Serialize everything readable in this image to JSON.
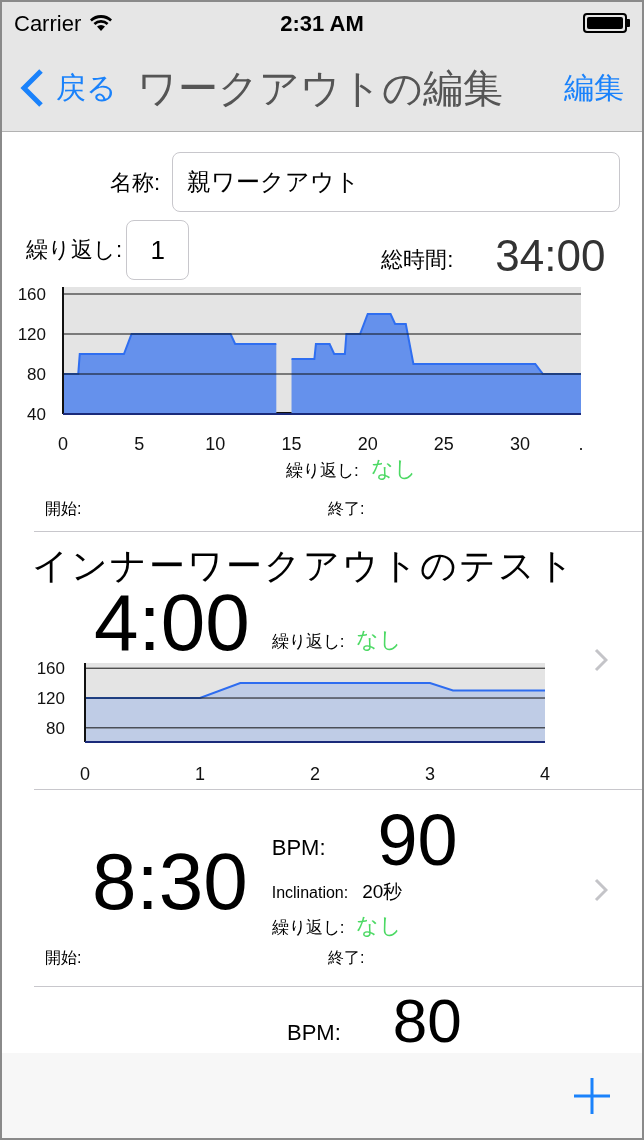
{
  "status_bar": {
    "carrier": "Carrier",
    "time": "2:31 AM"
  },
  "nav": {
    "back": "戻る",
    "title": "ワークアウトの編集",
    "action": "編集"
  },
  "name_field": {
    "label": "名称:",
    "value": "親ワークアウト"
  },
  "repeat_field": {
    "label": "繰り返し:",
    "value": "1"
  },
  "total": {
    "label": "総時間:",
    "value": "34:00"
  },
  "chart": {
    "chart_data": {
      "type": "area",
      "x": [
        0,
        1,
        1.1,
        4,
        4.5,
        11,
        11.3,
        14,
        14.5,
        15,
        16.5,
        16.6,
        17.5,
        17.8,
        18.5,
        18.6,
        19.5,
        20,
        21.5,
        21.8,
        22.5,
        23,
        31,
        31.5,
        34
      ],
      "grid": true,
      "series": [
        {
          "color": "#2f6ef0",
          "values": [
            80,
            80,
            100,
            100,
            120,
            120,
            110,
            110,
            null,
            95,
            95,
            110,
            110,
            100,
            100,
            120,
            120,
            140,
            140,
            130,
            130,
            90,
            90,
            80,
            80
          ]
        }
      ],
      "xlim": [
        0,
        34
      ],
      "ylim": [
        40,
        167
      ],
      "xticks": [
        0,
        5,
        10,
        15,
        20,
        25,
        30,
        {
          "value": 34,
          "label": "."
        }
      ],
      "yticks": [
        40,
        80,
        120,
        160
      ]
    }
  },
  "repeat": {
    "label": "繰り返し:",
    "value": "なし"
  },
  "start_label": "開始:",
  "end_label": "終了:",
  "items": [
    {
      "kind": "chart",
      "title": "インナーワークアウトのテスト",
      "time": "4:00",
      "repeat_label": "繰り返し:",
      "repeat_value": "なし",
      "chart_data": {
        "type": "area",
        "x": [
          0,
          1,
          1.35,
          3,
          3.2,
          4
        ],
        "grid": true,
        "series": [
          {
            "color": "#2d6cf0",
            "values": [
              120,
              120,
              140,
              140,
              130,
              130
            ]
          }
        ],
        "xlim": [
          0,
          4
        ],
        "ylim": [
          61,
          167
        ],
        "xticks": [
          0,
          1,
          2,
          3,
          4
        ],
        "yticks": [
          80,
          120,
          160
        ]
      }
    },
    {
      "kind": "bpm",
      "time": "8:30",
      "bpm_label": "BPM:",
      "bpm": "90",
      "inclination_label": "Inclination:",
      "inclination": "20秒",
      "repeat_label": "繰り返し:",
      "repeat_value": "なし",
      "start_label": "開始:",
      "end_label": "終了:"
    },
    {
      "kind": "partial",
      "bpm_label": "BPM:",
      "bpm": "80"
    }
  ]
}
